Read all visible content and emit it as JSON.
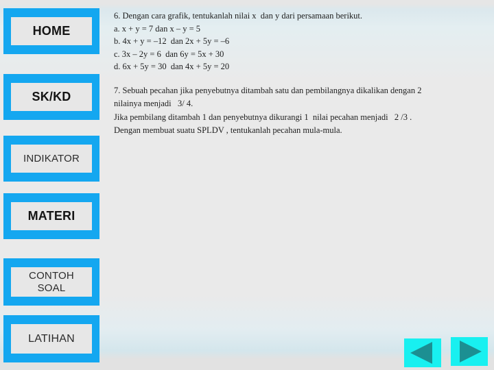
{
  "theme": {
    "accent_cyan": "#14a7f0",
    "button_face": "#e7e7e7",
    "arrow_bg": "#18f0f0",
    "arrow_glyph": "#1c8f92",
    "text": "#1d1d1d",
    "background": "#e9e9e9"
  },
  "sidebar": {
    "items": [
      {
        "id": "home",
        "label": "HOME"
      },
      {
        "id": "skkd",
        "label": "SK/KD"
      },
      {
        "id": "indikator",
        "label": "INDIKATOR"
      },
      {
        "id": "materi",
        "label": "MATERI"
      },
      {
        "id": "contoh",
        "label": "CONTOH\nSOAL"
      },
      {
        "id": "latihan",
        "label": "LATIHAN"
      }
    ]
  },
  "content": {
    "question6": {
      "lines": [
        "6. Dengan cara grafik, tentukanlah nilai x  dan y dari persamaan berikut.",
        "a. x + y = 7 dan x – y = 5",
        "b. 4x + y = –12  dan 2x + 5y = –6",
        "c. 3x – 2y = 6  dan 6y = 5x + 30",
        "d. 6x + 5y = 30  dan 4x + 5y = 20"
      ]
    },
    "question7": {
      "lines": [
        "7. Sebuah pecahan jika penyebutnya ditambah satu dan pembilangnya dikalikan dengan 2",
        "nilainya menjadi   3/ 4.",
        "Jika pembilang ditambah 1 dan penyebutnya dikurangi 1  nilai pecahan menjadi   2 /3 .",
        "Dengan membuat suatu SPLDV , tentukanlah pecahan mula-mula."
      ]
    }
  },
  "navigation": {
    "prev_label": "Previous slide",
    "next_label": "Next slide"
  }
}
